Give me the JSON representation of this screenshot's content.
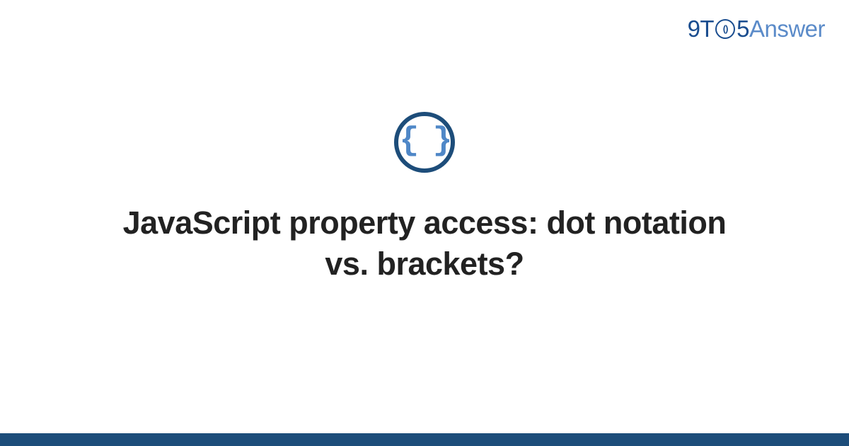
{
  "logo": {
    "part1": "9T",
    "clock_glyph": "()",
    "part2": "5",
    "part3": "Answer"
  },
  "icon": {
    "glyph": "{ }"
  },
  "title": "JavaScript property access: dot notation vs. brackets?",
  "colors": {
    "brand_dark": "#1a4d8f",
    "brand_light": "#5b8bc9",
    "footer": "#1d4d7a"
  }
}
